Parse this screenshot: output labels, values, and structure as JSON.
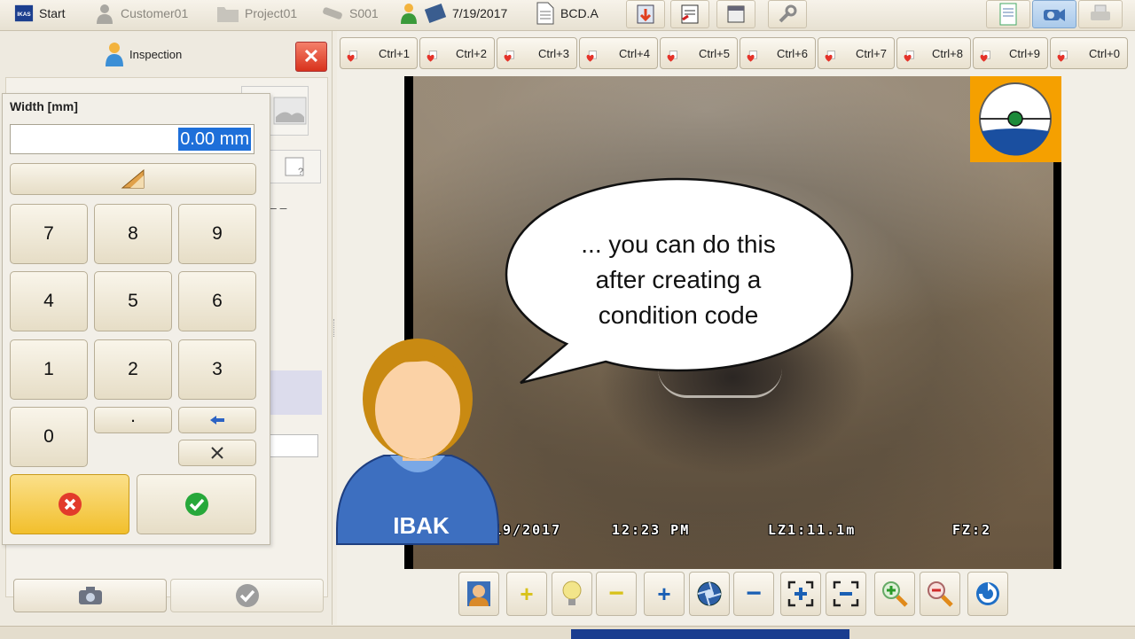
{
  "topbar": {
    "start": "Start",
    "customer": "Customer01",
    "project": "Project01",
    "section": "S001",
    "date": "7/19/2017",
    "file": "BCD.A"
  },
  "inspection": {
    "title": "Inspection"
  },
  "numpad": {
    "label": "Width [mm]",
    "value": "0.00 mm",
    "keys": [
      "7",
      "8",
      "9",
      "4",
      "5",
      "6",
      "1",
      "2",
      "3",
      "0",
      "."
    ]
  },
  "ctrl_buttons": [
    "Ctrl+1",
    "Ctrl+2",
    "Ctrl+3",
    "Ctrl+4",
    "Ctrl+5",
    "Ctrl+6",
    "Ctrl+7",
    "Ctrl+8",
    "Ctrl+9",
    "Ctrl+0"
  ],
  "video": {
    "osd_date": "19/2017",
    "osd_time": "12:23 PM",
    "osd_distance": "LZ1:11.1m",
    "osd_fz": "FZ:2"
  },
  "callout": {
    "text_line1": "... you can do this",
    "text_line2": "after creating a",
    "text_line3": "condition code"
  },
  "mascot": {
    "shirt_label": "IBAK"
  },
  "colors": {
    "accent_orange": "#f5a000",
    "cancel_yellow": "#f8d25a",
    "accent_blue": "#1a5fb4"
  }
}
